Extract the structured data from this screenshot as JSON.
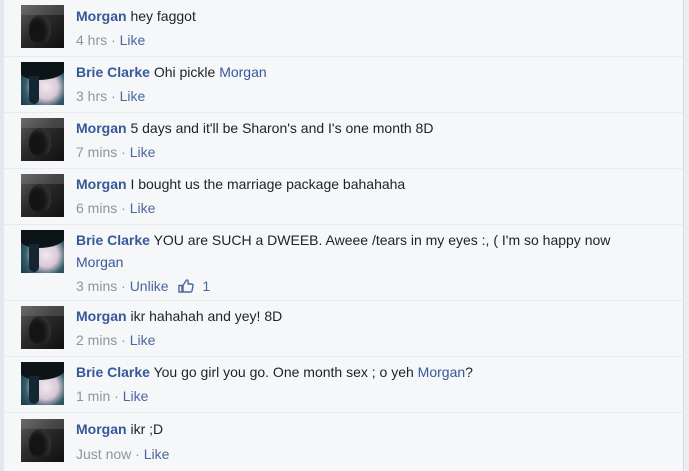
{
  "comments": [
    {
      "author": "Morgan",
      "message": "hey faggot",
      "mention": "",
      "tail": "",
      "time": "4 hrs",
      "separator": "·",
      "action": "Like",
      "like_count": ""
    },
    {
      "author": "Brie Clarke",
      "message": "Ohi pickle",
      "mention": "Morgan",
      "tail": "",
      "time": "3 hrs",
      "separator": "·",
      "action": "Like",
      "like_count": ""
    },
    {
      "author": "Morgan",
      "message": "5 days and it'll be Sharon's and I's one month 8D",
      "mention": "",
      "tail": "",
      "time": "7 mins",
      "separator": "·",
      "action": "Like",
      "like_count": ""
    },
    {
      "author": "Morgan",
      "message": "I bought us the marriage package bahahaha",
      "mention": "",
      "tail": "",
      "time": "6 mins",
      "separator": "·",
      "action": "Like",
      "like_count": ""
    },
    {
      "author": "Brie Clarke",
      "message": "YOU are SUCH a DWEEB. Aweee /tears in my eyes :, ( I'm so happy now",
      "mention": "Morgan",
      "tail": "",
      "time": "3 mins",
      "separator": "·",
      "action": "Unlike",
      "like_count": "1"
    },
    {
      "author": "Morgan",
      "message": "ikr hahahah and yey! 8D",
      "mention": "",
      "tail": "",
      "time": "2 mins",
      "separator": "·",
      "action": "Like",
      "like_count": ""
    },
    {
      "author": "Brie Clarke",
      "message": "You go girl you go. One month sex ; o yeh",
      "mention": "Morgan",
      "tail": "?",
      "time": "1 min",
      "separator": "·",
      "action": "Like",
      "like_count": ""
    },
    {
      "author": "Morgan",
      "message": "ikr ;D",
      "mention": "",
      "tail": "",
      "time": "Just now",
      "separator": "·",
      "action": "Like",
      "like_count": ""
    }
  ],
  "icons": {
    "avatar_morgan": "profile-photo-morgan",
    "avatar_brie": "profile-photo-brie",
    "like": "thumbs-up-icon"
  },
  "colors": {
    "name_link": "#365899",
    "meta_text": "#90949c",
    "action_link": "#4b67a1",
    "comment_bg": "#f6f7f9"
  }
}
